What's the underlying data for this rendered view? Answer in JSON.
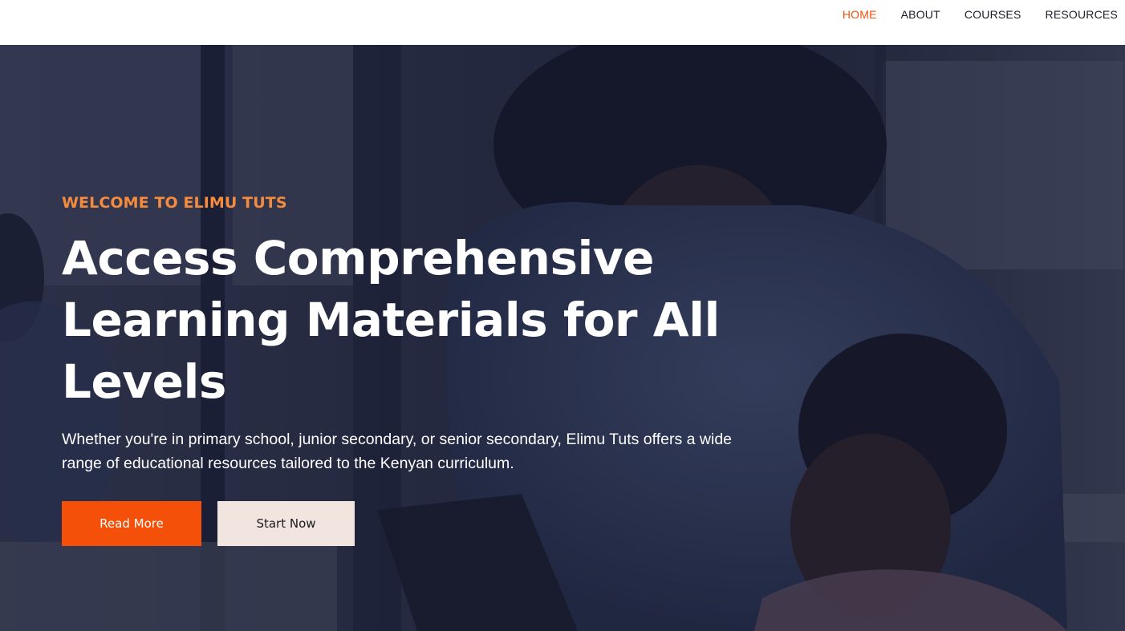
{
  "nav": {
    "items": [
      {
        "label": "HOME",
        "active": true
      },
      {
        "label": "ABOUT",
        "active": false
      },
      {
        "label": "COURSES",
        "active": false
      },
      {
        "label": "RESOURCES",
        "active": false
      }
    ]
  },
  "hero": {
    "eyebrow": "WELCOME TO ELIMU TUTS",
    "title": "Access Comprehensive Learning Materials for All Levels",
    "description": "Whether you're in primary school, junior secondary, or senior secondary, Elimu Tuts offers a wide range of educational resources tailored to the Kenyan curriculum.",
    "primary_button": "Read More",
    "secondary_button": "Start Now"
  },
  "colors": {
    "accent": "#f4500a",
    "eyebrow": "#f58b3c",
    "secondary_button_bg": "#f2e5e0",
    "overlay": "#161a30"
  }
}
